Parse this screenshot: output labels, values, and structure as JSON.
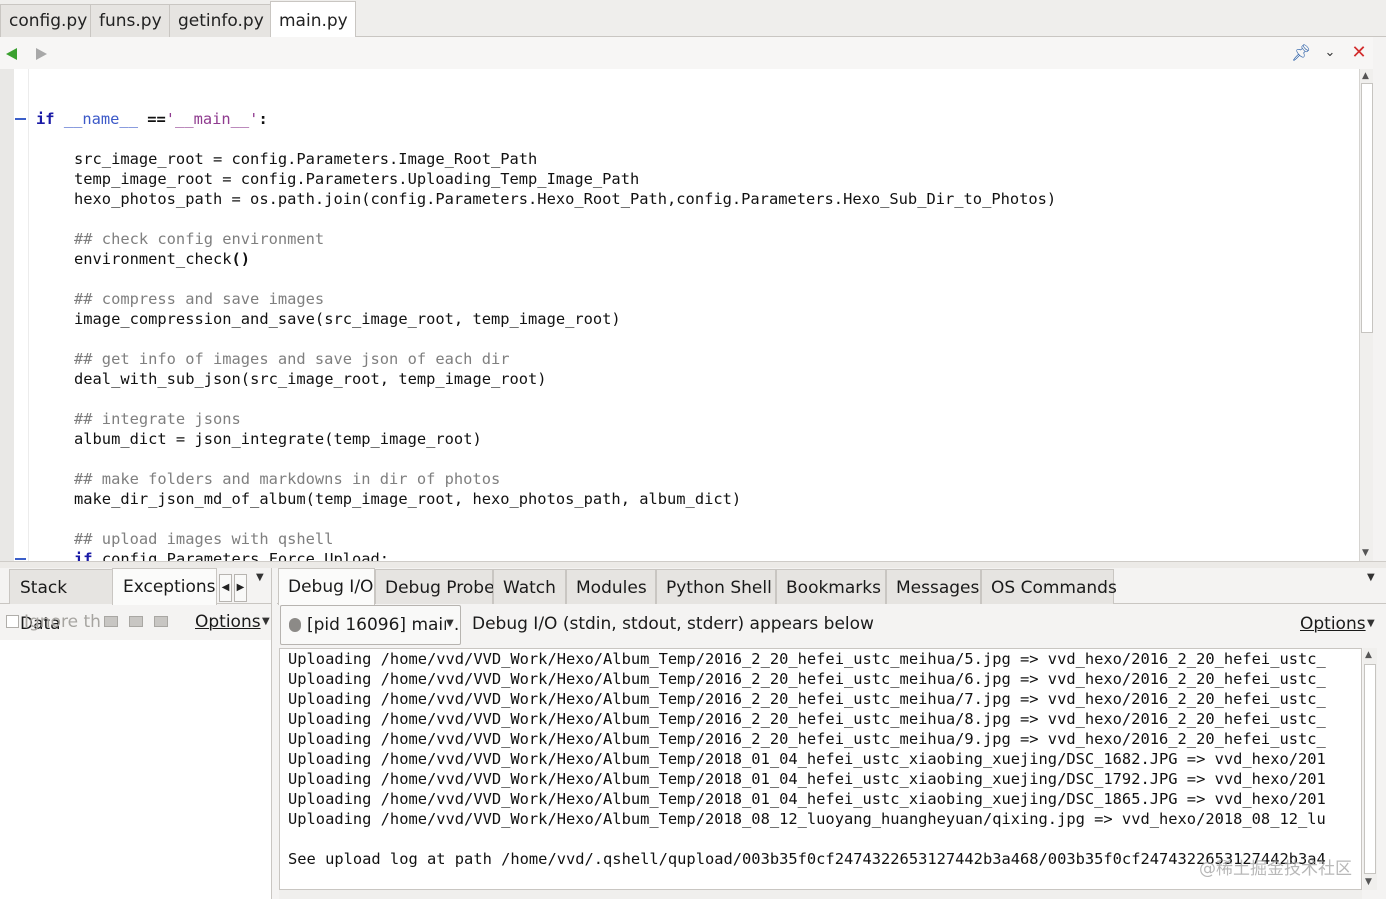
{
  "file_tabs": [
    {
      "label": "config.py"
    },
    {
      "label": "funs.py"
    },
    {
      "label": "getinfo.py"
    },
    {
      "label": "main.py",
      "active": true
    }
  ],
  "editor_toolbar": {
    "icons": [
      "back-arrow-icon",
      "forward-arrow-icon",
      "pin-icon",
      "chevron-down-icon",
      "close-icon"
    ],
    "colors": {
      "back": "#3aa02f",
      "close": "#d22b2b",
      "pin": "#2a5fa8"
    }
  },
  "code": {
    "line_if": {
      "kw": "if",
      "name": "__name__",
      "op": " ==",
      "str": "'__main__'",
      "colon": ":"
    },
    "line_src": "src_image_root = config.Parameters.Image_Root_Path",
    "line_temp": "temp_image_root = config.Parameters.Uploading_Temp_Image_Path",
    "line_hexo": "hexo_photos_path = os.path.join(config.Parameters.Hexo_Root_Path,config.Parameters.Hexo_Sub_Dir_to_Photos)",
    "c1": "## check config environment",
    "s1_name": "environment_check",
    "s1_args": "()",
    "c2": "## compress and save images",
    "s2_name": "image_compression_and_save",
    "s2_args": "(src_image_root, temp_image_root)",
    "c3": "## get info of images and save json of each dir",
    "s3_name": "deal_with_sub_json",
    "s3_args": "(src_image_root, temp_image_root)",
    "c4": "## integrate jsons",
    "s4_pre": "album_dict = ",
    "s4_name": "json_integrate",
    "s4_args": "(temp_image_root)",
    "c5": "## make folders and markdowns in dir of photos",
    "s5_name": "make_dir_json_md_of_album",
    "s5_args": "(temp_image_root, hexo_photos_path, album_dict)",
    "c6": "## upload images with qshell",
    "s6_kw": "if",
    "s6_rest": " config.Parameters.Force_Upload:"
  },
  "left_panel": {
    "tabs": [
      {
        "label": "Stack Data"
      },
      {
        "label": "Exceptions",
        "active": true
      }
    ],
    "ignore_label": "Ignore th",
    "options_label": "Options"
  },
  "right_panel": {
    "tabs": [
      {
        "label": "Debug I/O",
        "active": true
      },
      {
        "label": "Debug Probe"
      },
      {
        "label": "Watch"
      },
      {
        "label": "Modules"
      },
      {
        "label": "Python Shell"
      },
      {
        "label": "Bookmarks"
      },
      {
        "label": "Messages"
      },
      {
        "label": "OS Commands"
      }
    ],
    "process_select": "[pid 16096] main.p",
    "description": "Debug I/O (stdin, stdout, stderr) appears below",
    "options_label": "Options",
    "output_lines": [
      "Uploading /home/vvd/VVD_Work/Hexo/Album_Temp/2016_2_20_hefei_ustc_meihua/5.jpg => vvd_hexo/2016_2_20_hefei_ustc_",
      "Uploading /home/vvd/VVD_Work/Hexo/Album_Temp/2016_2_20_hefei_ustc_meihua/6.jpg => vvd_hexo/2016_2_20_hefei_ustc_",
      "Uploading /home/vvd/VVD_Work/Hexo/Album_Temp/2016_2_20_hefei_ustc_meihua/7.jpg => vvd_hexo/2016_2_20_hefei_ustc_",
      "Uploading /home/vvd/VVD_Work/Hexo/Album_Temp/2016_2_20_hefei_ustc_meihua/8.jpg => vvd_hexo/2016_2_20_hefei_ustc_",
      "Uploading /home/vvd/VVD_Work/Hexo/Album_Temp/2016_2_20_hefei_ustc_meihua/9.jpg => vvd_hexo/2016_2_20_hefei_ustc_",
      "Uploading /home/vvd/VVD_Work/Hexo/Album_Temp/2018_01_04_hefei_ustc_xiaobing_xuejing/DSC_1682.JPG => vvd_hexo/201",
      "Uploading /home/vvd/VVD_Work/Hexo/Album_Temp/2018_01_04_hefei_ustc_xiaobing_xuejing/DSC_1792.JPG => vvd_hexo/201",
      "Uploading /home/vvd/VVD_Work/Hexo/Album_Temp/2018_01_04_hefei_ustc_xiaobing_xuejing/DSC_1865.JPG => vvd_hexo/201",
      "Uploading /home/vvd/VVD_Work/Hexo/Album_Temp/2018_08_12_luoyang_huangheyuan/qixing.jpg => vvd_hexo/2018_08_12_lu",
      "",
      "See upload log at path /home/vvd/.qshell/qupload/003b35f0cf2474322653127442b3a468/003b35f0cf2474322653127442b3a4"
    ],
    "watermark": "@稀土掘金技术社区"
  }
}
